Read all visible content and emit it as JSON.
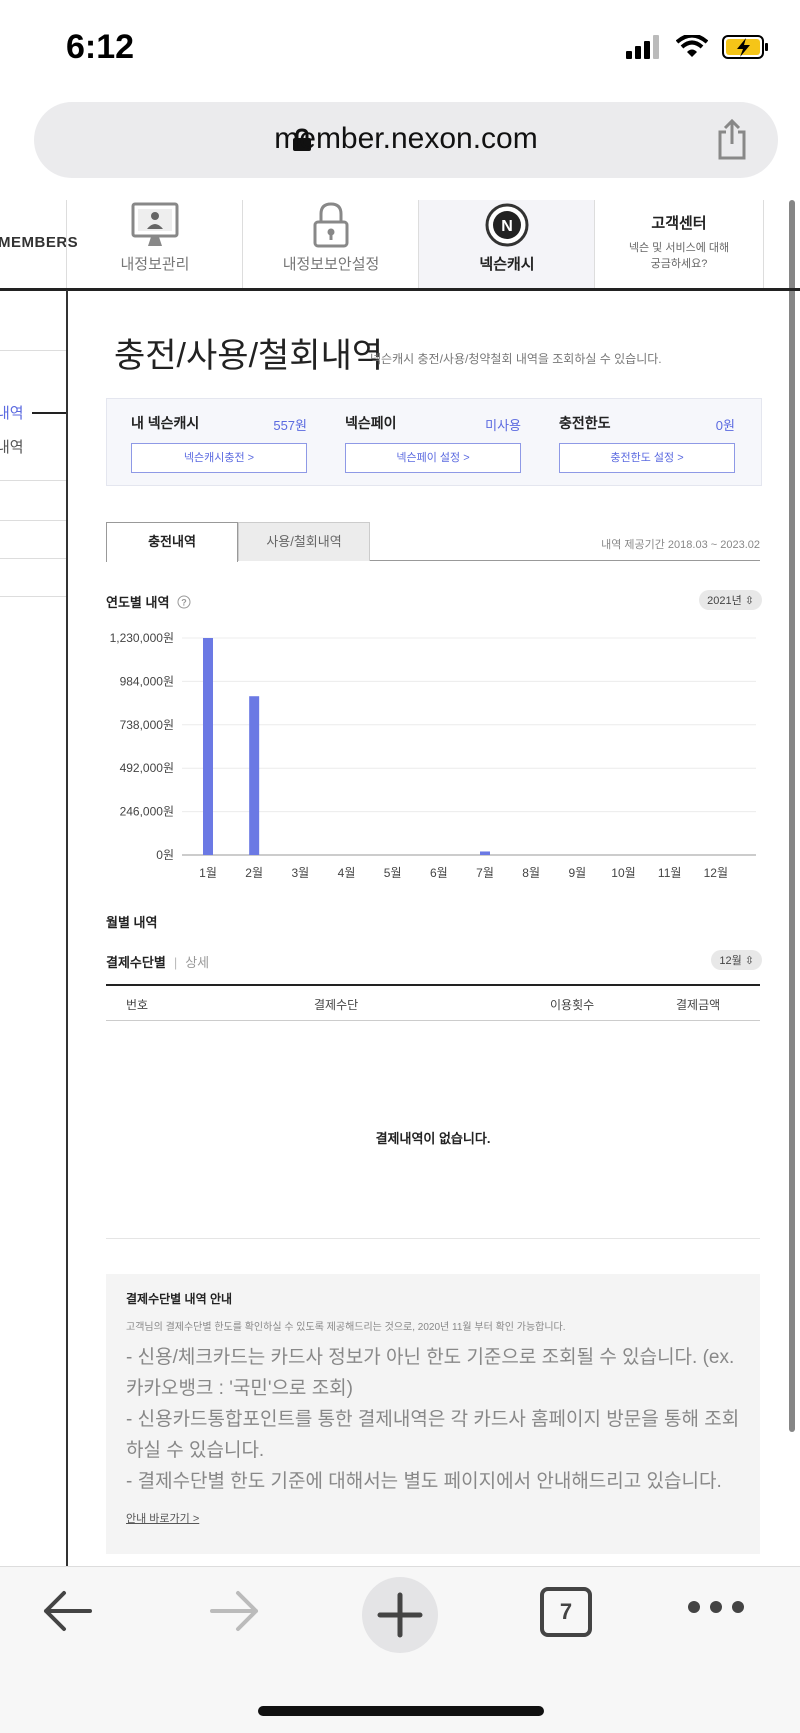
{
  "status_bar": {
    "time": "6:12"
  },
  "browser": {
    "url": "member.nexon.com",
    "tab_count": "7"
  },
  "nav": {
    "members_label": "MEMBERS",
    "items": [
      {
        "label": "내정보관리",
        "icon": "monitor-user-icon"
      },
      {
        "label": "내정보보안설정",
        "icon": "padlock-icon"
      },
      {
        "label": "넥슨캐시",
        "icon": "nexon-n-icon"
      },
      {
        "label": "고객센터",
        "sub1": "넥슨 및 서비스에 대해",
        "sub2": "궁금하세요?"
      }
    ]
  },
  "sidebar": {
    "item_active": "내역",
    "item_2": "내역"
  },
  "page": {
    "title": "충전/사용/철회내역",
    "subtitle": "넥슨캐시 충전/사용/청약철회 내역을 조회하실 수 있습니다."
  },
  "cash_box": [
    {
      "label": "내 넥슨캐시",
      "value": "557원",
      "button": "넥슨캐시충전 >"
    },
    {
      "label": "넥슨페이",
      "value": "미사용",
      "button": "넥슨페이 설정 >"
    },
    {
      "label": "충전한도",
      "value": "0원",
      "button": "충전한도 설정 >"
    }
  ],
  "tabs": {
    "active": "충전내역",
    "inactive": "사용/철회내역",
    "period": "내역 제공기간 2018.03 ~ 2023.02"
  },
  "yearly": {
    "title": "연도별 내역",
    "year_select": "2021년"
  },
  "chart_data": {
    "type": "bar",
    "categories": [
      "1월",
      "2월",
      "3월",
      "4월",
      "5월",
      "6월",
      "7월",
      "8월",
      "9월",
      "10월",
      "11월",
      "12월"
    ],
    "values": [
      1230000,
      900000,
      0,
      0,
      0,
      0,
      20000,
      0,
      0,
      0,
      0,
      0
    ],
    "ylim": [
      0,
      1230000
    ],
    "yticks": [
      0,
      246000,
      492000,
      738000,
      984000,
      1230000
    ],
    "ytick_labels": [
      "0원",
      "246,000원",
      "492,000원",
      "738,000원",
      "984,000원",
      "1,230,000원"
    ],
    "bar_color": "#6b79e4",
    "grid": true
  },
  "monthly": {
    "title": "월별 내역",
    "tab_active": "결제수단별",
    "tab_other": "상세",
    "month_select": "12월",
    "columns": [
      "번호",
      "결제수단",
      "이용횟수",
      "결제금액"
    ],
    "empty_message": "결제내역이 없습니다."
  },
  "notice": {
    "title": "결제수단별 내역 안내",
    "subtitle": "고객님의 결제수단별 한도를 확인하실 수 있도록 제공해드리는 것으로, 2020년 11월 부터 확인 가능합니다.",
    "line1": "- 신용/체크카드는 카드사 정보가 아닌 한도 기준으로 조회될 수 있습니다. (ex. 카카오뱅크 : '국민'으로 조회)",
    "line2": "- 신용카드통합포인트를 통한 결제내역은 각 카드사 홈페이지 방문을 통해 조회하실 수 있습니다.",
    "line3": "- 결제수단별 한도 기준에 대해서는 별도 페이지에서 안내해드리고 있습니다.",
    "link": "안내 바로가기 >"
  },
  "colors": {
    "accent": "#5b6ae0",
    "bar": "#6b79e4"
  }
}
